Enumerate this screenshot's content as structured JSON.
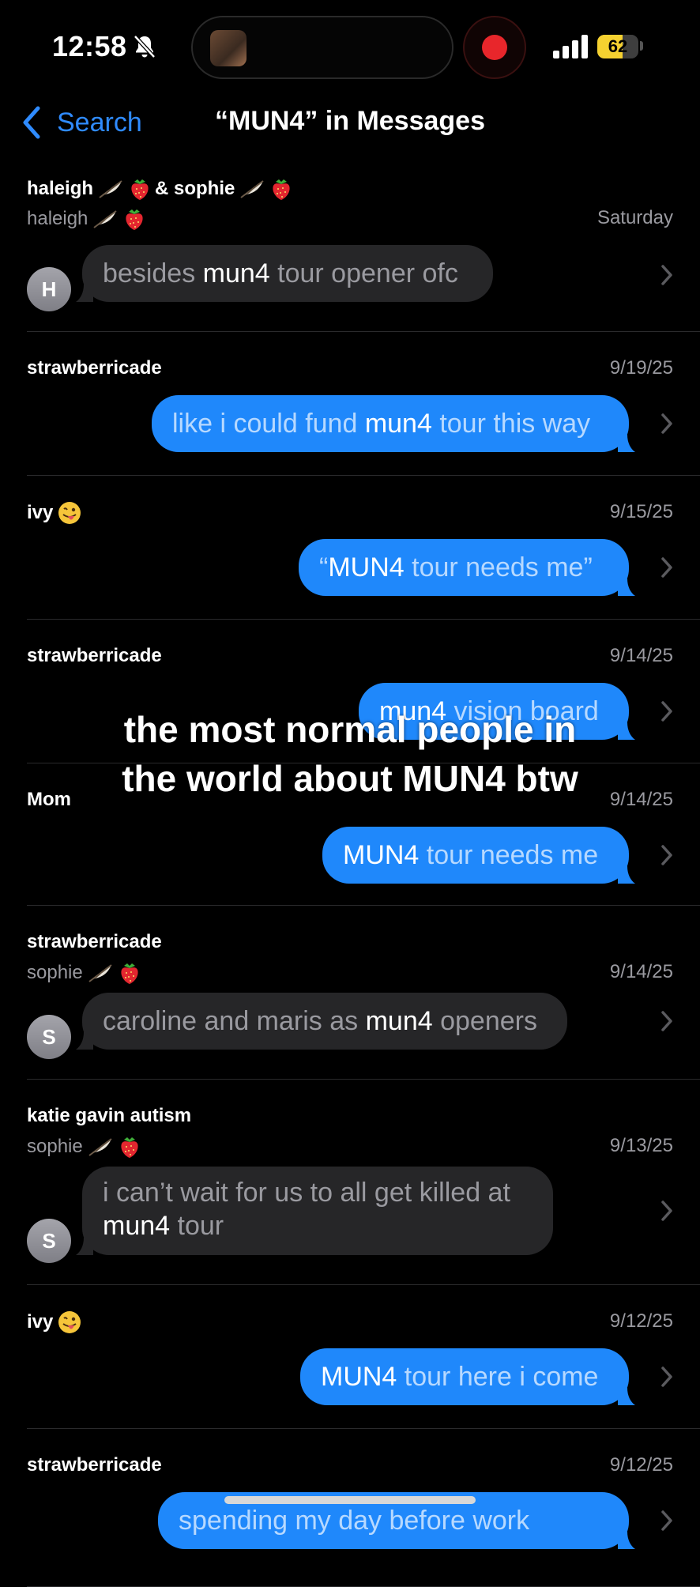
{
  "status_bar": {
    "time": "12:58",
    "battery_percent": "62",
    "battery_level": 0.62,
    "muted_icon": "bell-slash-icon",
    "recording_icon": "record-icon"
  },
  "nav": {
    "back_label": "Search",
    "title": "“MUN4” in Messages"
  },
  "colors": {
    "accent": "#2f8bff",
    "outgoing_bubble": "#1f88fb",
    "incoming_bubble": "#262628",
    "background": "#000000"
  },
  "results": [
    {
      "conversation": "haleigh",
      "conversation_extra": "& sophie",
      "conversation_emojis": [
        "feather-emoji",
        "strawberry-emoji"
      ],
      "sender": "haleigh",
      "sender_emojis": [
        "feather-emoji",
        "strawberry-emoji"
      ],
      "date": "Saturday",
      "direction": "in",
      "avatar": "H",
      "segments": [
        {
          "t": "besides ",
          "h": false
        },
        {
          "t": "mun4",
          "h": true
        },
        {
          "t": " tour opener ofc",
          "h": false
        }
      ]
    },
    {
      "conversation": "strawberricade",
      "date": "9/19/25",
      "direction": "out",
      "segments": [
        {
          "t": "like i could fund ",
          "h": false
        },
        {
          "t": "mun4",
          "h": true
        },
        {
          "t": " tour this way",
          "h": false
        }
      ]
    },
    {
      "conversation": "ivy",
      "conversation_emojis": [
        "tongue-out-emoji"
      ],
      "date": "9/15/25",
      "direction": "out",
      "segments": [
        {
          "t": "“",
          "h": false
        },
        {
          "t": "MUN4",
          "h": true
        },
        {
          "t": " tour needs me”",
          "h": false
        }
      ]
    },
    {
      "conversation": "strawberricade",
      "date": "9/14/25",
      "direction": "out",
      "segments": [
        {
          "t": "mun4",
          "h": true
        },
        {
          "t": " vision board",
          "h": false
        }
      ]
    },
    {
      "conversation": "Mom",
      "date": "9/14/25",
      "direction": "out",
      "segments": [
        {
          "t": "MUN4",
          "h": true
        },
        {
          "t": " tour needs me",
          "h": false
        }
      ]
    },
    {
      "conversation": "strawberricade",
      "sender": "sophie",
      "sender_emojis": [
        "feather-emoji",
        "strawberry-emoji"
      ],
      "date": "9/14/25",
      "direction": "in",
      "avatar": "S",
      "segments": [
        {
          "t": "caroline and maris as ",
          "h": false
        },
        {
          "t": "mun4",
          "h": true
        },
        {
          "t": " openers",
          "h": false
        }
      ]
    },
    {
      "conversation": "katie gavin autism",
      "sender": "sophie",
      "sender_emojis": [
        "feather-emoji",
        "strawberry-emoji"
      ],
      "date": "9/13/25",
      "direction": "in",
      "avatar": "S",
      "segments": [
        {
          "t": "i can’t wait for us to all get killed at ",
          "h": false
        },
        {
          "t": "mun4",
          "h": true
        },
        {
          "t": " tour",
          "h": false
        }
      ]
    },
    {
      "conversation": "ivy",
      "conversation_emojis": [
        "tongue-out-emoji"
      ],
      "date": "9/12/25",
      "direction": "out",
      "segments": [
        {
          "t": "MUN4",
          "h": true
        },
        {
          "t": " tour here i come",
          "h": false
        }
      ]
    },
    {
      "conversation": "strawberricade",
      "date": "9/12/25",
      "direction": "out",
      "segments": [
        {
          "t": "spending my day before work",
          "h": false
        }
      ]
    }
  ],
  "overlay_caption": {
    "line1": "the most  normal people in",
    "line2": "the world about MUN4 btw"
  }
}
